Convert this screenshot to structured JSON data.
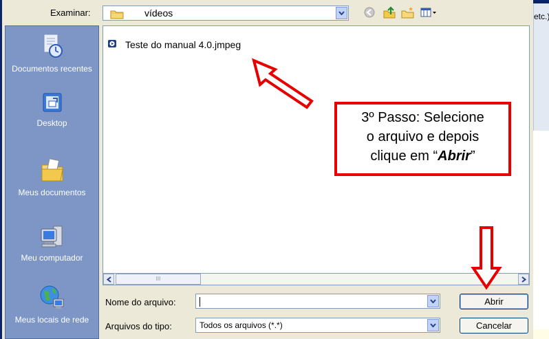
{
  "dialog": {
    "look_in_label": "Examinar:",
    "look_in_value": "vídeos",
    "toolbar_icons": [
      "back-icon",
      "up-folder-icon",
      "new-folder-icon",
      "views-menu-icon"
    ]
  },
  "places": [
    {
      "label": "Documentos recentes",
      "icon": "recent-documents-icon"
    },
    {
      "label": "Desktop",
      "icon": "desktop-icon"
    },
    {
      "label": "Meus documentos",
      "icon": "my-documents-icon"
    },
    {
      "label": "Meu computador",
      "icon": "my-computer-icon"
    },
    {
      "label": "Meus locais de rede",
      "icon": "network-places-icon"
    }
  ],
  "files": [
    {
      "name": "Teste do manual 4.0.jmpeg",
      "icon": "media-file-icon"
    }
  ],
  "form": {
    "filename_label": "Nome do arquivo:",
    "filename_value": "",
    "filetype_label": "Arquivos do tipo:",
    "filetype_value": "Todos os arquivos (*.*)",
    "open_label": "Abrir",
    "cancel_label": "Cancelar"
  },
  "scrollbar": {
    "thumb_grip": "III"
  },
  "background": {
    "fragment_text": "etc.)"
  },
  "annotation": {
    "line1": "3º Passo: Selecione",
    "line2": "o arquivo e depois",
    "line3_prefix": "clique em “",
    "line3_emph": "Abrir",
    "line3_suffix": "”",
    "color": "#e60000"
  }
}
